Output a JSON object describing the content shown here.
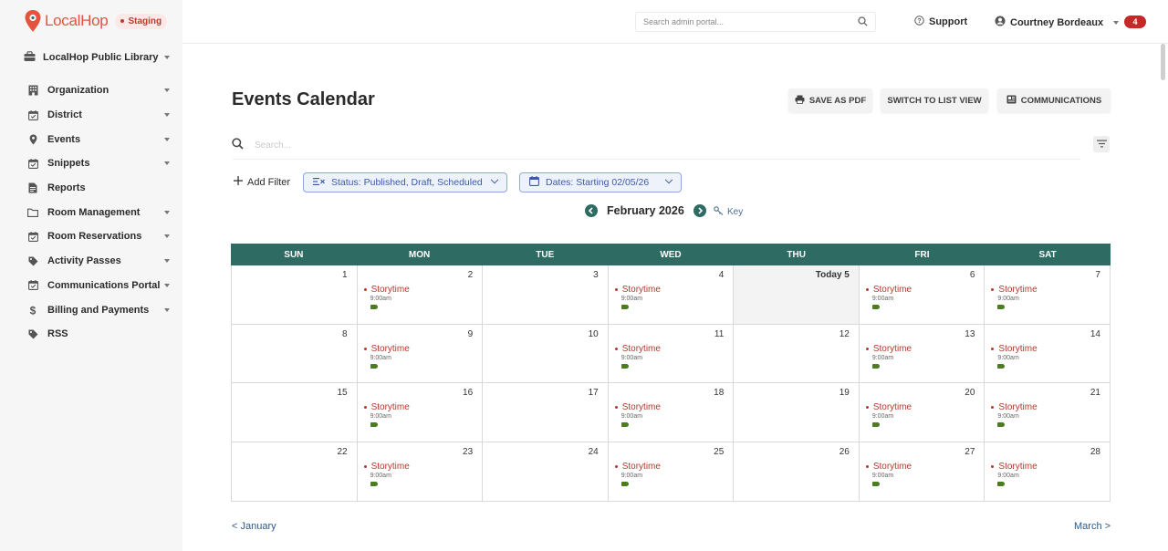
{
  "brand": {
    "name": "LocalHop",
    "env": "Staging"
  },
  "org": {
    "name": "LocalHop Public Library"
  },
  "nav": [
    {
      "label": "Organization",
      "icon": "building-icon",
      "expandable": true
    },
    {
      "label": "District",
      "icon": "calendar-check-icon",
      "expandable": true
    },
    {
      "label": "Events",
      "icon": "pin-icon",
      "expandable": true
    },
    {
      "label": "Snippets",
      "icon": "calendar-check-icon",
      "expandable": true
    },
    {
      "label": "Reports",
      "icon": "document-icon",
      "expandable": false
    },
    {
      "label": "Room Management",
      "icon": "folder-icon",
      "expandable": true
    },
    {
      "label": "Room Reservations",
      "icon": "calendar-check-icon",
      "expandable": true
    },
    {
      "label": "Activity Passes",
      "icon": "tag-icon",
      "expandable": true
    },
    {
      "label": "Communications Portal",
      "icon": "calendar-check-icon",
      "expandable": true
    },
    {
      "label": "Billing and Payments",
      "icon": "dollar-icon",
      "expandable": true
    },
    {
      "label": "RSS",
      "icon": "tag-icon",
      "expandable": false
    }
  ],
  "topbar": {
    "search_placeholder": "Search admin portal...",
    "support": "Support",
    "user": "Courtney Bordeaux",
    "notifications": "4"
  },
  "page": {
    "title": "Events Calendar",
    "buttons": {
      "pdf": "SAVE AS PDF",
      "list": "SWITCH TO LIST VIEW",
      "comm": "COMMUNICATIONS"
    },
    "search_placeholder": "Search...",
    "add_filter": "Add Filter",
    "filters": {
      "status": "Status: Published, Draft, Scheduled",
      "dates": "Dates: Starting 02/05/26"
    },
    "month": "February 2026",
    "key": "Key",
    "prev": "< January",
    "next": "March >"
  },
  "calendar": {
    "weekdays": [
      "SUN",
      "MON",
      "TUE",
      "WED",
      "THU",
      "FRI",
      "SAT"
    ],
    "event_title": "Storytime",
    "event_time": "9:00am",
    "weeks": [
      [
        {
          "day": "1"
        },
        {
          "day": "2",
          "event": true
        },
        {
          "day": "3"
        },
        {
          "day": "4",
          "event": true
        },
        {
          "day": "Today 5",
          "today": true
        },
        {
          "day": "6",
          "event": true
        },
        {
          "day": "7",
          "event": true
        }
      ],
      [
        {
          "day": "8"
        },
        {
          "day": "9",
          "event": true
        },
        {
          "day": "10"
        },
        {
          "day": "11",
          "event": true
        },
        {
          "day": "12"
        },
        {
          "day": "13",
          "event": true
        },
        {
          "day": "14",
          "event": true
        }
      ],
      [
        {
          "day": "15"
        },
        {
          "day": "16",
          "event": true
        },
        {
          "day": "17"
        },
        {
          "day": "18",
          "event": true
        },
        {
          "day": "19"
        },
        {
          "day": "20",
          "event": true
        },
        {
          "day": "21",
          "event": true
        }
      ],
      [
        {
          "day": "22"
        },
        {
          "day": "23",
          "event": true
        },
        {
          "day": "24"
        },
        {
          "day": "25",
          "event": true
        },
        {
          "day": "26"
        },
        {
          "day": "27",
          "event": true
        },
        {
          "day": "28",
          "event": true
        }
      ]
    ]
  },
  "colors": {
    "brand": "#e5533d",
    "teal": "#2e6b63",
    "event": "#b23a2c",
    "tag": "#4d7c1f"
  }
}
